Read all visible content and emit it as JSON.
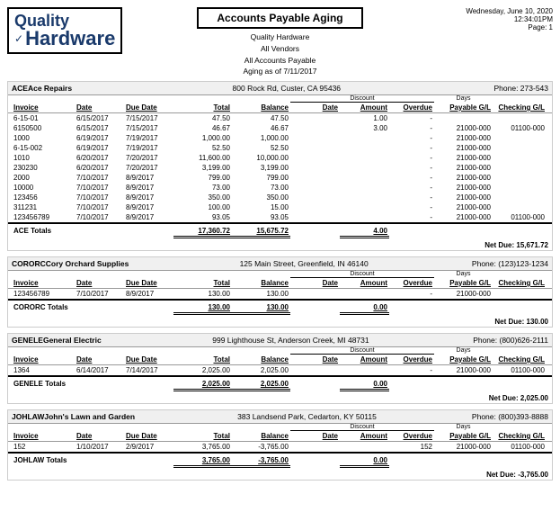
{
  "header": {
    "logo_quality": "Quality",
    "logo_hardware": "Hardware",
    "report_title": "Accounts Payable Aging",
    "subtitle_line1": "Quality Hardware",
    "subtitle_line2": "All Vendors",
    "subtitle_line3": "All Accounts Payable",
    "subtitle_line4": "Aging as of 7/11/2017",
    "date_line1": "Wednesday, June 10, 2020",
    "date_line2": "12:34:01PM",
    "date_line3": "Page: 1"
  },
  "columns": {
    "invoice": "Invoice",
    "date": "Date",
    "due_date": "Due Date",
    "total": "Total",
    "balance": "Balance",
    "disc_date": "Date",
    "disc_amount": "Amount",
    "days_overdue": "Overdue",
    "payable_gl": "Payable G/L",
    "checking_gl": "Checking G/L",
    "discount_header": "Discount",
    "days_header": "Days"
  },
  "vendors": [
    {
      "id": "ACE",
      "name": "Ace Repairs",
      "address": "800 Rock Rd, Custer, CA 95436",
      "phone": "Phone: 273-543",
      "invoices": [
        {
          "invoice": "6-15-01",
          "date": "6/15/2017",
          "due_date": "7/15/2017",
          "total": "47.50",
          "balance": "47.50",
          "disc_date": "",
          "disc_amount": "1.00",
          "days_overdue": "-",
          "payable_gl": "",
          "checking_gl": ""
        },
        {
          "invoice": "6150500",
          "date": "6/15/2017",
          "due_date": "7/15/2017",
          "total": "46.67",
          "balance": "46.67",
          "disc_date": "",
          "disc_amount": "3.00",
          "days_overdue": "-",
          "payable_gl": "21000-000",
          "checking_gl": "01100-000"
        },
        {
          "invoice": "1000",
          "date": "6/19/2017",
          "due_date": "7/19/2017",
          "total": "1,000.00",
          "balance": "1,000.00",
          "disc_date": "",
          "disc_amount": "",
          "days_overdue": "-",
          "payable_gl": "21000-000",
          "checking_gl": ""
        },
        {
          "invoice": "6-15-002",
          "date": "6/19/2017",
          "due_date": "7/19/2017",
          "total": "52.50",
          "balance": "52.50",
          "disc_date": "",
          "disc_amount": "",
          "days_overdue": "-",
          "payable_gl": "21000-000",
          "checking_gl": ""
        },
        {
          "invoice": "1010",
          "date": "6/20/2017",
          "due_date": "7/20/2017",
          "total": "11,600.00",
          "balance": "10,000.00",
          "disc_date": "",
          "disc_amount": "",
          "days_overdue": "-",
          "payable_gl": "21000-000",
          "checking_gl": ""
        },
        {
          "invoice": "230230",
          "date": "6/20/2017",
          "due_date": "7/20/2017",
          "total": "3,199.00",
          "balance": "3,199.00",
          "disc_date": "",
          "disc_amount": "",
          "days_overdue": "-",
          "payable_gl": "21000-000",
          "checking_gl": ""
        },
        {
          "invoice": "2000",
          "date": "7/10/2017",
          "due_date": "8/9/2017",
          "total": "799.00",
          "balance": "799.00",
          "disc_date": "",
          "disc_amount": "",
          "days_overdue": "-",
          "payable_gl": "21000-000",
          "checking_gl": ""
        },
        {
          "invoice": "10000",
          "date": "7/10/2017",
          "due_date": "8/9/2017",
          "total": "73.00",
          "balance": "73.00",
          "disc_date": "",
          "disc_amount": "",
          "days_overdue": "-",
          "payable_gl": "21000-000",
          "checking_gl": ""
        },
        {
          "invoice": "123456",
          "date": "7/10/2017",
          "due_date": "8/9/2017",
          "total": "350.00",
          "balance": "350.00",
          "disc_date": "",
          "disc_amount": "",
          "days_overdue": "-",
          "payable_gl": "21000-000",
          "checking_gl": ""
        },
        {
          "invoice": "311231",
          "date": "7/10/2017",
          "due_date": "8/9/2017",
          "total": "100.00",
          "balance": "15.00",
          "disc_date": "",
          "disc_amount": "",
          "days_overdue": "-",
          "payable_gl": "21000-000",
          "checking_gl": ""
        },
        {
          "invoice": "123456789",
          "date": "7/10/2017",
          "due_date": "8/9/2017",
          "total": "93.05",
          "balance": "93.05",
          "disc_date": "",
          "disc_amount": "",
          "days_overdue": "-",
          "payable_gl": "21000-000",
          "checking_gl": "01100-000"
        }
      ],
      "totals": {
        "label": "ACE Totals",
        "total": "17,360.72",
        "balance": "15,675.72",
        "disc_amount": "4.00",
        "net_due": "15,671.72"
      }
    },
    {
      "id": "CORORC",
      "name": "Cory Orchard Supplies",
      "address": "125 Main Street, Greenfield, IN 46140",
      "phone": "Phone: (123)123-1234",
      "invoices": [
        {
          "invoice": "123456789",
          "date": "7/10/2017",
          "due_date": "8/9/2017",
          "total": "130.00",
          "balance": "130.00",
          "disc_date": "",
          "disc_amount": "",
          "days_overdue": "-",
          "payable_gl": "21000-000",
          "checking_gl": ""
        }
      ],
      "totals": {
        "label": "CORORC Totals",
        "total": "130.00",
        "balance": "130.00",
        "disc_amount": "0.00",
        "net_due": "130.00"
      }
    },
    {
      "id": "GENELE",
      "name": "General Electric",
      "address": "999 Lighthouse St, Anderson Creek, MI 48731",
      "phone": "Phone: (800)626-2111",
      "invoices": [
        {
          "invoice": "1364",
          "date": "6/14/2017",
          "due_date": "7/14/2017",
          "total": "2,025.00",
          "balance": "2,025.00",
          "disc_date": "",
          "disc_amount": "",
          "days_overdue": "-",
          "payable_gl": "21000-000",
          "checking_gl": "01100-000"
        }
      ],
      "totals": {
        "label": "GENELE Totals",
        "total": "2,025.00",
        "balance": "2,025.00",
        "disc_amount": "0.00",
        "net_due": "2,025.00"
      }
    },
    {
      "id": "JOHLAW",
      "name": "John's Lawn and Garden",
      "address": "383 Landsend Park, Cedarton, KY 50115",
      "phone": "Phone: (800)393-8888",
      "invoices": [
        {
          "invoice": "152",
          "date": "1/10/2017",
          "due_date": "2/9/2017",
          "total": "3,765.00",
          "balance": "-3,765.00",
          "disc_date": "",
          "disc_amount": "",
          "days_overdue": "152",
          "payable_gl": "21000-000",
          "checking_gl": "01100-000"
        }
      ],
      "totals": {
        "label": "JOHLAW Totals",
        "total": "3,765.00",
        "balance": "-3,765.00",
        "disc_amount": "0.00",
        "net_due": "-3,765.00"
      }
    }
  ]
}
